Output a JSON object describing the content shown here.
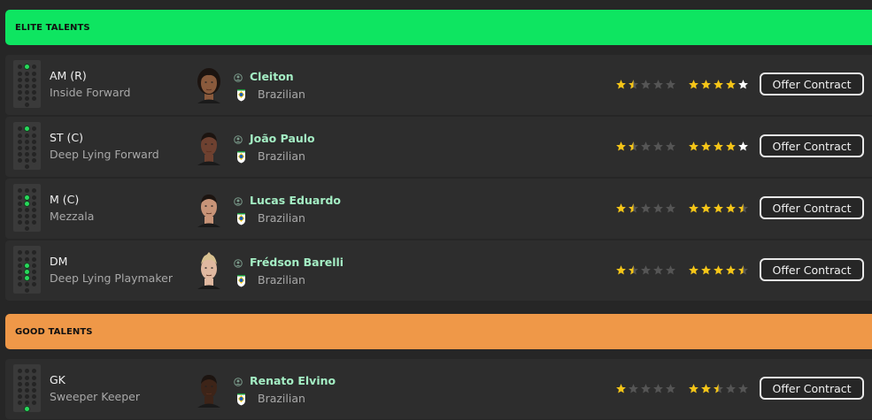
{
  "sections": [
    {
      "title": "ELITE TALENTS",
      "color": "#0ee561",
      "players": [
        {
          "position": "AM (R)",
          "role": "Inside Forward",
          "name": "Cleiton",
          "nationality": "Brazilian",
          "current_ability_stars": 1.5,
          "potential_ability_stars": 5,
          "potential_last_star_white": true,
          "pitch_dots": [
            "am-r"
          ],
          "skin": "#8a5a3c",
          "hair": "long-dark",
          "action": "Offer Contract"
        },
        {
          "position": "ST (C)",
          "role": "Deep Lying Forward",
          "name": "João Paulo",
          "nationality": "Brazilian",
          "current_ability_stars": 1.5,
          "potential_ability_stars": 5,
          "potential_last_star_white": true,
          "pitch_dots": [
            "st-c"
          ],
          "skin": "#6e4130",
          "hair": "short-dark",
          "action": "Offer Contract"
        },
        {
          "position": "M (C)",
          "role": "Mezzala",
          "name": "Lucas Eduardo",
          "nationality": "Brazilian",
          "current_ability_stars": 1.5,
          "potential_ability_stars": 4.5,
          "pitch_dots": [
            "mc-l",
            "mc-c"
          ],
          "skin": "#c89478",
          "hair": "short-dark",
          "action": "Offer Contract"
        },
        {
          "position": "DM",
          "role": "Deep Lying Playmaker",
          "name": "Frédson Barelli",
          "nationality": "Brazilian",
          "current_ability_stars": 1.5,
          "potential_ability_stars": 4.5,
          "pitch_dots": [
            "dm-l",
            "dm-c",
            "dm-r"
          ],
          "skin": "#e0b8a0",
          "hair": "blonde",
          "action": "Offer Contract"
        }
      ]
    },
    {
      "title": "GOOD TALENTS",
      "color": "#ef9848",
      "players": [
        {
          "position": "GK",
          "role": "Sweeper Keeper",
          "name": "Renato Elvino",
          "nationality": "Brazilian",
          "current_ability_stars": 1,
          "potential_ability_stars": 2.5,
          "pitch_dots": [
            "gk"
          ],
          "skin": "#3d2418",
          "hair": "short-dark",
          "action": "Offer Contract"
        }
      ]
    }
  ],
  "colors": {
    "star_gold": "#f5c518",
    "star_empty": "#555555",
    "star_white": "#ffffff",
    "name_green": "#a4eec4"
  },
  "icons": [
    "person-icon",
    "brazil-flag-icon",
    "star-icon",
    "pitch-position-icon"
  ]
}
